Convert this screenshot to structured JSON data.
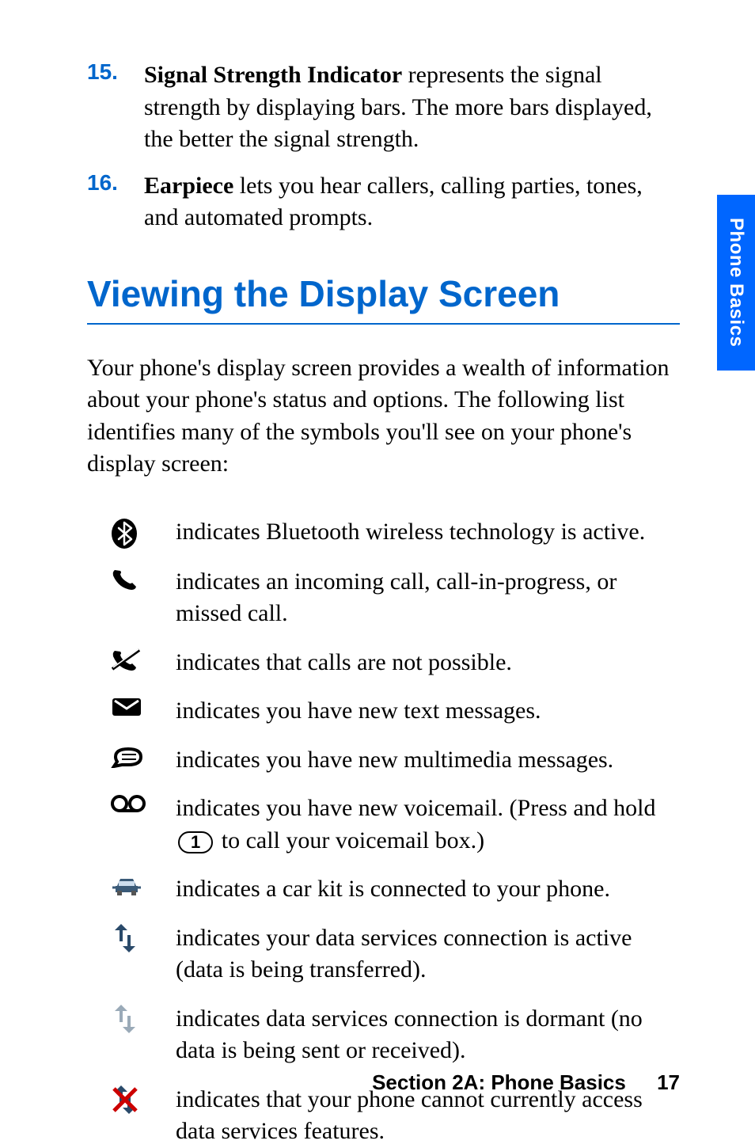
{
  "numbered": [
    {
      "num": "15.",
      "term": "Signal Strength Indicator",
      "rest": " represents the signal strength by displaying bars. The more bars displayed, the better the signal strength."
    },
    {
      "num": "16.",
      "term": "Earpiece",
      "rest": " lets you hear callers, calling parties, tones, and automated prompts."
    }
  ],
  "section_title": "Viewing the Display Screen",
  "intro": "Your phone's display screen provides a wealth of information about your phone's status and options. The following list identifies many of the symbols you'll see on your phone's display screen:",
  "icons": [
    {
      "name": "bluetooth-icon",
      "desc": "indicates Bluetooth wireless technology is active."
    },
    {
      "name": "call-icon",
      "desc": "indicates an incoming call, call-in-progress, or missed call."
    },
    {
      "name": "no-call-icon",
      "desc": "indicates that calls are not possible."
    },
    {
      "name": "text-message-icon",
      "desc": "indicates you have new text messages."
    },
    {
      "name": "mms-message-icon",
      "desc": "indicates you have new multimedia messages."
    },
    {
      "name": "voicemail-icon",
      "desc_pre": "indicates you have new voicemail. (Press and hold ",
      "key": "1",
      "desc_post": " to call your voicemail box.)"
    },
    {
      "name": "car-kit-icon",
      "desc": "indicates a car kit is connected to your phone."
    },
    {
      "name": "data-active-icon",
      "desc": "indicates your data services connection is active (data is being transferred)."
    },
    {
      "name": "data-dormant-icon",
      "desc": "indicates data services connection is dormant (no data is being sent or received)."
    },
    {
      "name": "data-unavailable-icon",
      "desc": "indicates that your phone cannot currently access data services features."
    }
  ],
  "side_tab": "Phone Basics",
  "footer_section": "Section 2A: Phone Basics",
  "footer_page": "17",
  "voicemail_key": "1"
}
